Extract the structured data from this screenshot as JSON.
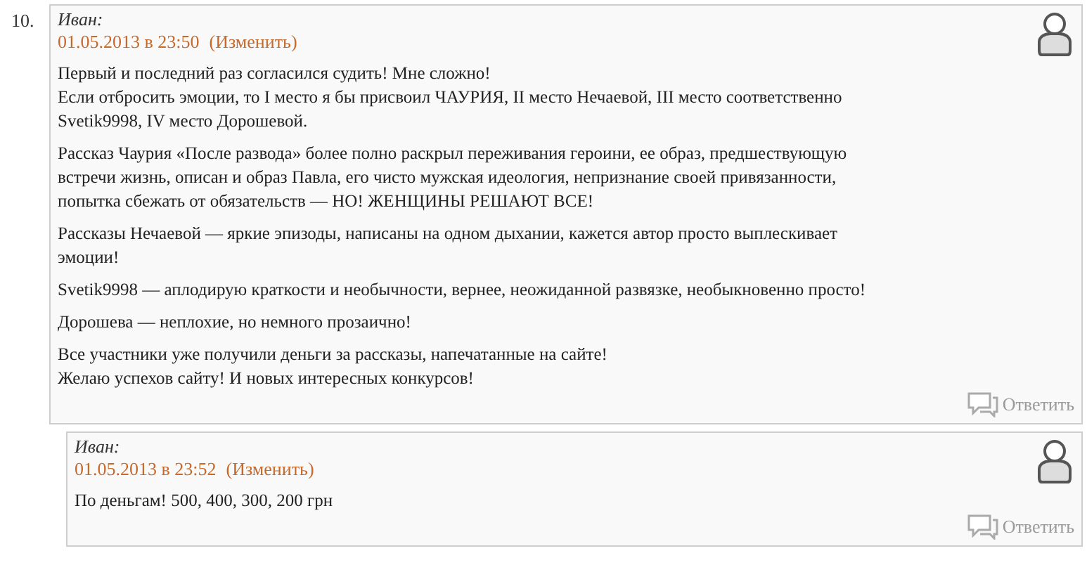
{
  "comments": [
    {
      "number": "10.",
      "author": "Иван:",
      "date": "01.05.2013 в 23:50",
      "edit_link": "(Изменить)",
      "reply_link": "Ответить",
      "paragraphs": [
        [
          "Первый и последний раз согласился судить! Мне сложно!",
          "Если отбросить эмоции, то I место я бы присвоил ЧАУРИЯ, II место Нечаевой, III место соответственно",
          "Svetik9998, IV место Дорошевой."
        ],
        [
          "Рассказ Чаурия «После развода» более полно раскрыл переживания героини, ее образ, предшествующую",
          "встречи жизнь, описан и образ Павла, его чисто мужская идеология, непризнание своей привязанности,",
          "попытка сбежать от обязательств — НО! ЖЕНЩИНЫ РЕШАЮТ ВСЕ!"
        ],
        [
          "Рассказы Нечаевой — яркие эпизоды, написаны на одном дыхании, кажется автор просто выплескивает",
          "эмоции!"
        ],
        [
          "Svetik9998 — аплодирую краткости и необычности, вернее, неожиданной развязке, необыкновенно просто!"
        ],
        [
          "Дорошева — неплохие, но немного прозаично!"
        ],
        [
          "Все участники уже получили деньги за рассказы, напечатанные на сайте!",
          "Желаю успехов сайту! И новых интересных конкурсов!"
        ]
      ],
      "children": [
        {
          "author": "Иван:",
          "date": "01.05.2013 в 23:52",
          "edit_link": "(Изменить)",
          "reply_link": "Ответить",
          "paragraphs": [
            [
              "По деньгам! 500, 400, 300, 200 грн"
            ]
          ]
        }
      ]
    }
  ]
}
